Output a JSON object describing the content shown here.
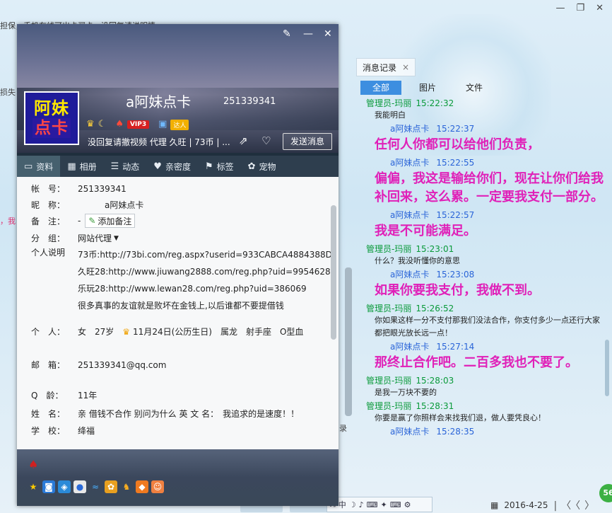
{
  "chat_window": {
    "top_text": "担保，手机在线可出卡买卡，没回复请说明情",
    "edge_texts": [
      "损失",
      "，我"
    ],
    "dropdown_fragment": "录",
    "back_buttons": [
      "",
      ""
    ]
  },
  "history": {
    "title": "消息记录",
    "close_glyph": "×",
    "filters": [
      "全部",
      "图片",
      "文件"
    ],
    "messages": [
      {
        "kind": "admin",
        "sender": "管理员-玛丽",
        "time": "15:22:32",
        "text": "我能明白",
        "big": false
      },
      {
        "kind": "self",
        "sender": "a阿妹点卡",
        "time": "15:22:37",
        "text": "任何人你都可以给他们负责，",
        "big": true
      },
      {
        "kind": "self",
        "sender": "a阿妹点卡",
        "time": "15:22:55",
        "text": "偏偏，我这是输给你们，现在让你们给我补回来，这么累。一定要我支付一部分。",
        "big": true
      },
      {
        "kind": "self",
        "sender": "a阿妹点卡",
        "time": "15:22:57",
        "text": "我是不可能满足。",
        "big": true
      },
      {
        "kind": "admin",
        "sender": "管理员-玛丽",
        "time": "15:23:01",
        "text": "什么？我没听懂你的意思",
        "big": false
      },
      {
        "kind": "self",
        "sender": "a阿妹点卡",
        "time": "15:23:08",
        "text": "如果你要我支付，我做不到。",
        "big": true
      },
      {
        "kind": "admin",
        "sender": "管理员-玛丽",
        "time": "15:26:52",
        "text": "你如果这样一分不支付那我们没法合作，你支付多少一点还行大家都把眼光放长远一点！",
        "big": false
      },
      {
        "kind": "self",
        "sender": "a阿妹点卡",
        "time": "15:27:14",
        "text": "那终止合作吧。二百多我也不要了。",
        "big": true
      },
      {
        "kind": "admin",
        "sender": "管理员-玛丽",
        "time": "15:28:03",
        "text": "是我一万块不要的",
        "big": false
      },
      {
        "kind": "admin",
        "sender": "管理员-玛丽",
        "time": "15:28:31",
        "text": "你要是赢了你照样会来找我们退，做人要凭良心！",
        "big": false
      },
      {
        "kind": "self",
        "sender": "a阿妹点卡",
        "time": "15:28:35",
        "text": "",
        "big": true
      }
    ],
    "date": "2016-4-25",
    "nav_glyphs": "|〈〈〉",
    "badge": "56"
  },
  "emoji_toolbar": [
    "⛶",
    "中",
    "☽",
    "♪",
    "⌨",
    "✦",
    "⌨",
    "⚙"
  ],
  "profile": {
    "window_controls": {
      "skin": "✎",
      "minimize": "—",
      "close": "✕"
    },
    "avatar_line1": "阿妹",
    "avatar_line2": "点卡",
    "nickname": "a阿妹点卡",
    "qq_number": "251339341",
    "badges": {
      "vip": "VIP3",
      "daren": "达人"
    },
    "signature": "没回复请撤视频 代理 久旺 | 73币 | ...",
    "send_button": "发送消息",
    "tabs": [
      {
        "icon": "▭",
        "label": "资料",
        "name": "profile-info"
      },
      {
        "icon": "▦",
        "label": "相册",
        "name": "album"
      },
      {
        "icon": "☰",
        "label": "动态",
        "name": "feed"
      },
      {
        "icon": "♥",
        "label": "亲密度",
        "name": "intimacy"
      },
      {
        "icon": "⚑",
        "label": "标签",
        "name": "tags"
      },
      {
        "icon": "✿",
        "label": "宠物",
        "name": "pet"
      }
    ],
    "fields": {
      "account_label": "帐　号：",
      "account": "251339341",
      "nick_label": "昵　称：",
      "nick": "a阿妹点卡",
      "remark_label": "备　注：",
      "remark": "-",
      "add_remark": "添加备注",
      "group_label": "分　组：",
      "group": "网站代理",
      "desc_label": "个人说明",
      "desc_lines": [
        "73币:http://73bi.com/reg.aspx?userid=933CABCA4884388D",
        "久旺28:http://www.jiuwang2888.com/reg.php?uid=9954628",
        "乐玩28:http://www.lewan28.com/reg.php?uid=386069",
        "很多真事的友谊就是败坏在金钱上,以后谁都不要提借钱"
      ],
      "personal_label": "个　人：",
      "personal": "女　27岁",
      "birthday": "11月24日(公历生日)",
      "zodiac": "属龙",
      "sign": "射手座",
      "blood": "O型血",
      "email_label": "邮　箱：",
      "email": "251339341@qq.com",
      "qage_label": "Q　龄：",
      "qage": "11年",
      "name_label": "姓　名：",
      "name": "亲 借钱不合作 别问为什么 英 文 名：　我追求的是速度！！",
      "school_label": "学　校：",
      "school": "绛福"
    }
  }
}
